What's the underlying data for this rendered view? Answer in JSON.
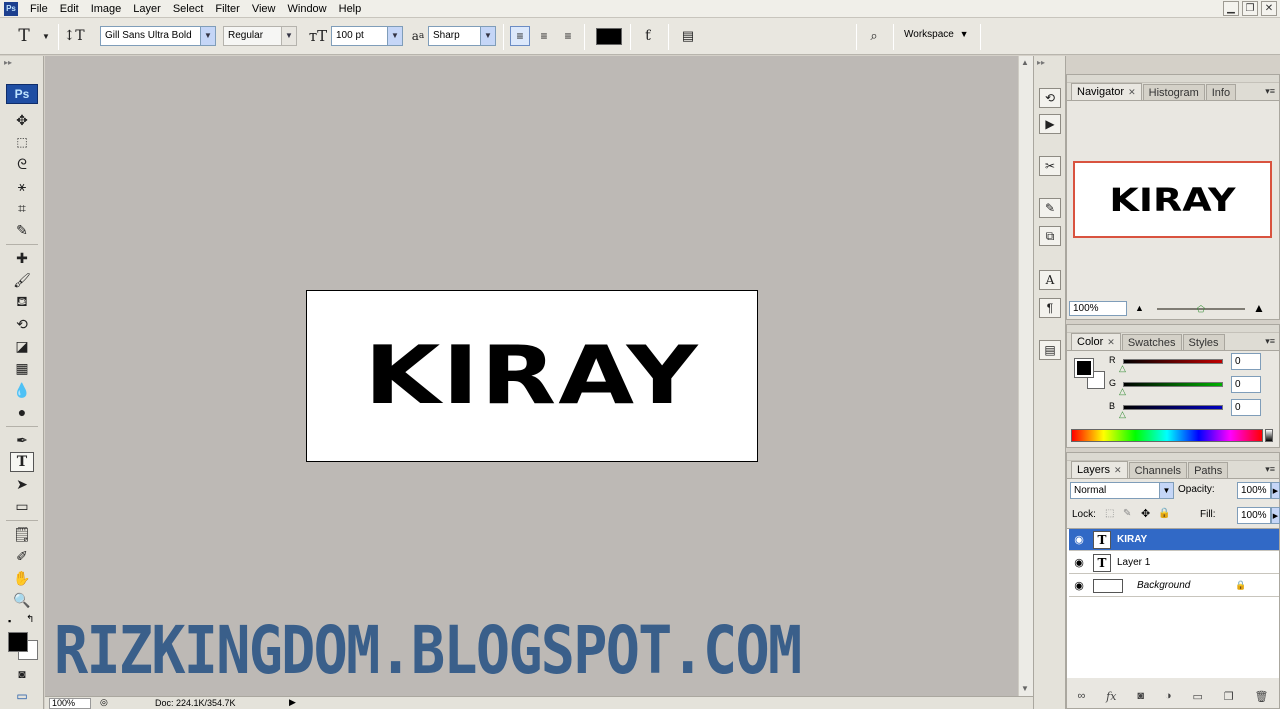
{
  "menu": [
    "File",
    "Edit",
    "Image",
    "Layer",
    "Select",
    "Filter",
    "View",
    "Window",
    "Help"
  ],
  "app_icon": "Ps",
  "options_bar": {
    "font_family": "Gill Sans Ultra Bold",
    "font_style": "Regular",
    "font_size": "100 pt",
    "antialias_prefix": "a",
    "antialias_label": "a",
    "antialias": "Sharp",
    "text_color": "#000000",
    "workspace": "Workspace",
    "workspace_arrow": "▼"
  },
  "toolbar": {
    "ps_logo": "Ps"
  },
  "document": {
    "text": "KIRAY"
  },
  "watermark": "RIZKINGDOM.BLOGSPOT.COM",
  "status": {
    "zoom": "100%",
    "doc": "Doc: 224.1K/354.7K"
  },
  "navigator": {
    "tabs": [
      "Navigator",
      "Histogram",
      "Info"
    ],
    "preview_text": "KIRAY",
    "zoom": "100%",
    "zoom_level": 0.5
  },
  "color_panel": {
    "tabs": [
      "Color",
      "Swatches",
      "Styles"
    ],
    "channels": [
      {
        "label": "R",
        "value": "0",
        "color": "#c00000"
      },
      {
        "label": "G",
        "value": "0",
        "color": "#00b000"
      },
      {
        "label": "B",
        "value": "0",
        "color": "#0000c0"
      }
    ]
  },
  "layers_panel": {
    "tabs": [
      "Layers",
      "Channels",
      "Paths"
    ],
    "blend_mode": "Normal",
    "opacity_label": "Opacity:",
    "opacity": "100%",
    "lock_label": "Lock:",
    "fill_label": "Fill:",
    "fill": "100%",
    "layers": [
      {
        "name": "KIRAY",
        "type": "text",
        "selected": true
      },
      {
        "name": "Layer 1",
        "type": "text",
        "selected": false
      },
      {
        "name": "Background",
        "type": "image",
        "selected": false,
        "locked": true
      }
    ]
  },
  "colors": {
    "selection": "#3169c6",
    "watermark": "#3a5f8a",
    "canvas_bg": "#bdb9b5"
  }
}
